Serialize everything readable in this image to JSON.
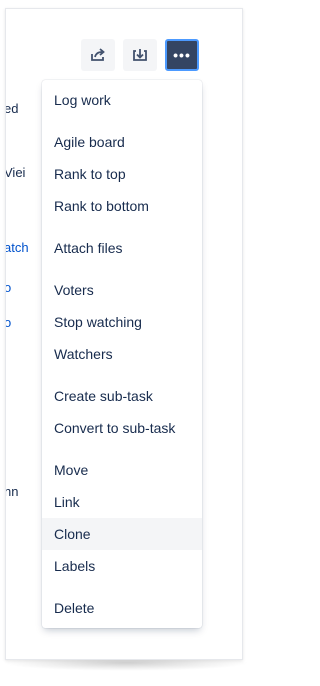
{
  "toolbar": {
    "buttons": [
      {
        "name": "share",
        "icon": "share-icon"
      },
      {
        "name": "export",
        "icon": "export-icon"
      },
      {
        "name": "more",
        "icon": "more-icon",
        "label": "•••"
      }
    ],
    "accent_color": "#344563",
    "focus_color": "#4c9aff"
  },
  "background_text": [
    {
      "text": "ed"
    },
    {
      "text": "Viei"
    },
    {
      "text": "atch"
    },
    {
      "text": "o"
    },
    {
      "text": "o"
    },
    {
      "text": "nn"
    }
  ],
  "menu": {
    "groups": [
      {
        "items": [
          "Log work"
        ]
      },
      {
        "items": [
          "Agile board",
          "Rank to top",
          "Rank to bottom"
        ]
      },
      {
        "items": [
          "Attach files"
        ]
      },
      {
        "items": [
          "Voters",
          "Stop watching",
          "Watchers"
        ]
      },
      {
        "items": [
          "Create sub-task",
          "Convert to sub-task"
        ]
      },
      {
        "items": [
          "Move",
          "Link",
          "Clone",
          "Labels"
        ]
      },
      {
        "items": [
          "Delete"
        ]
      }
    ],
    "highlighted_item": "Clone"
  }
}
